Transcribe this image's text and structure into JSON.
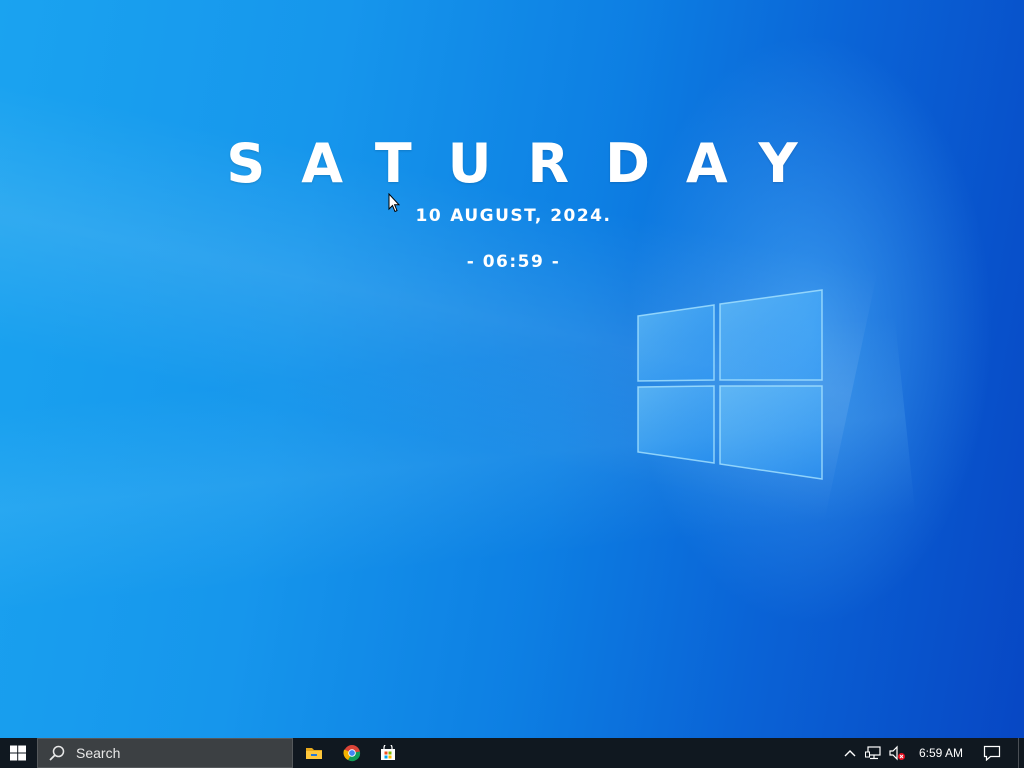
{
  "desktop": {
    "wallpaper": "Windows 10 hero wallpaper",
    "accent_color": "#0f7fe3",
    "widget": {
      "day": "SATURDAY",
      "date_day": "10",
      "date_month_year": "AUGUST, 2024.",
      "time": "- 06:59 -"
    }
  },
  "taskbar": {
    "start_icon": "windows-logo-icon",
    "search": {
      "placeholder": "Search",
      "icon": "search-icon"
    },
    "pinned_apps": [
      {
        "name": "File Explorer",
        "icon": "file-explorer-icon"
      },
      {
        "name": "Google Chrome",
        "icon": "chrome-icon"
      },
      {
        "name": "Microsoft Store",
        "icon": "store-icon"
      }
    ],
    "tray": {
      "chevron_icon": "chevron-up-icon",
      "network_icon": "network-icon",
      "volume_icon": "volume-muted-icon",
      "time": "6:59 AM",
      "notification_icon": "action-center-icon"
    }
  }
}
